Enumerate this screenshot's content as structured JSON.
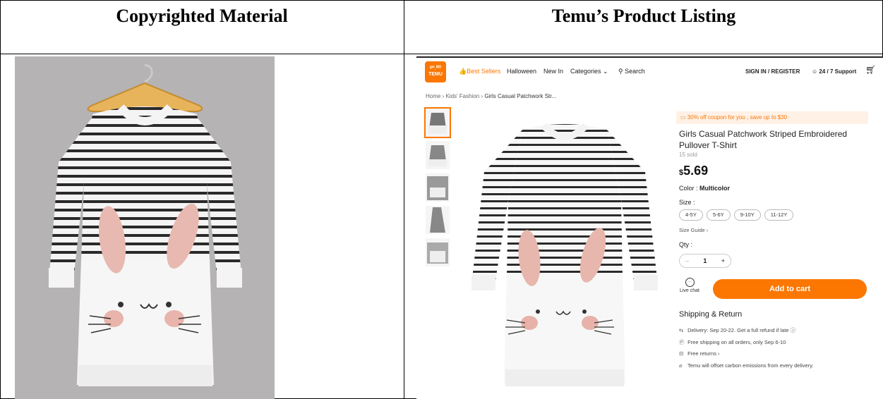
{
  "headers": {
    "left": "Copyrighted Material",
    "right": "Temu’s Product Listing"
  },
  "temu": {
    "logo_text": [
      "ᵍᵐ˳ᴹᴼ",
      "TEMU"
    ],
    "nav": {
      "best_sellers": "Best Sellers",
      "halloween": "Halloween",
      "new_in": "New In",
      "categories": "Categories",
      "search": "Search",
      "sign_in": "SIGN IN / REGISTER",
      "support": "24 / 7 Support"
    },
    "breadcrumb": [
      "Home",
      "Kids' Fashion",
      "Girls Casual Patchwork Str..."
    ],
    "coupon": "30% off coupon for you , save up to $30",
    "title": "Girls Casual Patchwork Striped Embroidered Pullover T-Shirt",
    "sold": "15 sold",
    "price_symbol": "$",
    "price": "5.69",
    "color_label": "Color :",
    "color_value": "Multicolor",
    "size_label": "Size :",
    "sizes": [
      "4-5Y",
      "5-6Y",
      "9-10Y",
      "11-12Y"
    ],
    "size_guide": "Size Guide ›",
    "qty_label": "Qty :",
    "qty": {
      "minus": "–",
      "value": "1",
      "plus": "+"
    },
    "live_chat": "Live chat",
    "add_to_cart": "Add to cart",
    "shipping_title": "Shipping & Return",
    "shipping_lines": [
      "Delivery: Sep 20-22. Get a full refund if late",
      "Free shipping on all orders, only Sep 6-10",
      "Free returns ›",
      "Temu will offset carbon emissions from every delivery."
    ],
    "accent": "#fb7701"
  }
}
